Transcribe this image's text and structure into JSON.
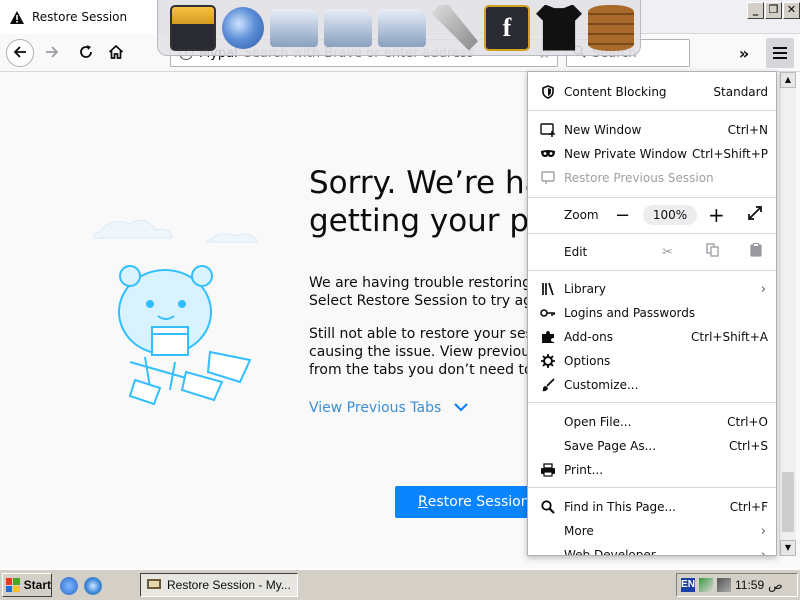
{
  "tab": {
    "title": "Restore Session"
  },
  "window_controls": {
    "minimize": "_",
    "restore": "❐",
    "close": "✕"
  },
  "navbar": {
    "site_label": "Mypal",
    "url_placeholder": "Search with Brave or enter address",
    "search_placeholder": "Search"
  },
  "page": {
    "title_line1": "Sorry. We’re ha",
    "title_line2": "getting your pa",
    "para1_line1": "We are having trouble restoring y",
    "para1_line2": "Select Restore Session to try aga",
    "para2_line1": "Still not able to restore your sess",
    "para2_line2": "causing the issue. View previous",
    "para2_line3": "from the tabs you don’t need to re",
    "view_previous": "View Previous Tabs",
    "restore_button_underlined": "R",
    "restore_button_rest": "estore Session"
  },
  "menu": {
    "content_blocking": {
      "label": "Content Blocking",
      "value": "Standard"
    },
    "new_window": {
      "label": "New Window",
      "shortcut": "Ctrl+N"
    },
    "new_private_window": {
      "label": "New Private Window",
      "shortcut": "Ctrl+Shift+P"
    },
    "restore_previous_session": {
      "label": "Restore Previous Session"
    },
    "zoom": {
      "label": "Zoom",
      "minus": "−",
      "value": "100%",
      "plus": "+"
    },
    "edit": {
      "label": "Edit"
    },
    "library": {
      "label": "Library"
    },
    "logins": {
      "label": "Logins and Passwords"
    },
    "addons": {
      "label": "Add-ons",
      "shortcut": "Ctrl+Shift+A"
    },
    "options": {
      "label": "Options"
    },
    "customize": {
      "label": "Customize..."
    },
    "open_file": {
      "label": "Open File...",
      "shortcut": "Ctrl+O"
    },
    "save_page": {
      "label": "Save Page As...",
      "shortcut": "Ctrl+S"
    },
    "print": {
      "label": "Print..."
    },
    "find": {
      "label": "Find in This Page...",
      "shortcut": "Ctrl+F"
    },
    "more": {
      "label": "More"
    },
    "web_developer": {
      "label": "Web Developer"
    }
  },
  "taskbar": {
    "start": "Start",
    "task_item": "Restore Session - My...",
    "clock": "11:59",
    "clock_suffix": "ص"
  },
  "colors": {
    "accent": "#0a84ff",
    "link": "#3a8fd6",
    "menu_border": "#b1b1b3",
    "taskbar": "#d4d0c8"
  }
}
